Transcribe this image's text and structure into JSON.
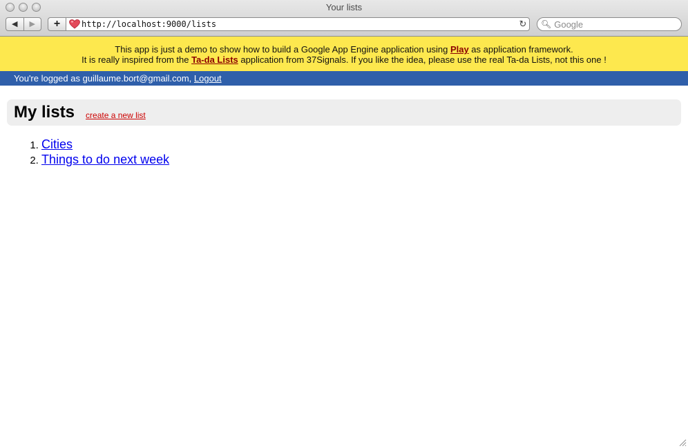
{
  "window": {
    "title": "Your lists"
  },
  "browser": {
    "back_label": "◀",
    "forward_label": "▶",
    "add_label": "+",
    "url": "http://localhost:9000/lists",
    "reload_label": "↻",
    "search_placeholder": "Google"
  },
  "notice": {
    "line1_prefix": "This app is just a demo to show how to build a Google App Engine application using ",
    "line1_link": "Play",
    "line1_suffix": " as application framework.",
    "line2_prefix": "It is really inspired from the ",
    "line2_link": "Ta-da Lists",
    "line2_suffix": " application from 37Signals. If you like the idea, please use the real Ta-da Lists, not this one !"
  },
  "user": {
    "logged_text": "You're logged as guillaume.bort@gmail.com, ",
    "logout_label": "Logout"
  },
  "main": {
    "heading": "My lists",
    "create_link": "create a new list",
    "lists": [
      {
        "label": "Cities"
      },
      {
        "label": "Things to do next week"
      }
    ]
  },
  "colors": {
    "notice_bg": "#fde84e",
    "userbar_bg": "#2f5faa",
    "link": "#0000ee",
    "create_link": "#cc0000"
  }
}
